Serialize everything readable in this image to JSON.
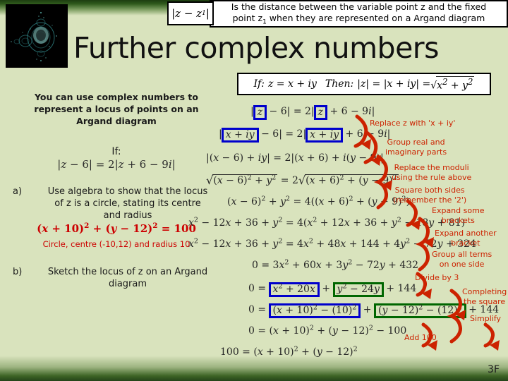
{
  "slide": {
    "page_number": "3F",
    "title": "Further complex numbers",
    "colors": {
      "background": "#d9e3bd",
      "band_dark_green": "#24441a",
      "annotation_red": "#cc2200",
      "answer_red": "#cc0000",
      "highlight_blue": "#0000cc",
      "highlight_green": "#006600"
    }
  },
  "header": {
    "modulus_label": "|z − z",
    "modulus_sub": "1",
    "modulus_tail": "|",
    "definition_line1": "Is the distance between the variable point z and the fixed",
    "definition_line2a": "point z",
    "definition_sub": "1",
    "definition_line2b": " when they are represented on a Argand diagram",
    "fractal_alt": "mandelbrot-fractal-image"
  },
  "rule_box": {
    "if_label": "If:",
    "if_expr": "z = x + iy",
    "then_label": "Then:",
    "then_expr": "|z| = |x + iy| = ",
    "then_radical": "√x² + y²"
  },
  "left": {
    "intro_line1": "You can use complex numbers to",
    "intro_line2": "represent a locus of points on an",
    "intro_line3": "Argand diagram",
    "if_word": "If:",
    "if_equation": "|z − 6| = 2|z + 6 − 9i|",
    "question_a_label": "a)",
    "question_a_line1": "Use algebra to show that the locus",
    "question_a_line2": "of z is a circle, stating its centre",
    "question_a_line3": "and radius",
    "answer_a_equation": "(x + 10)² + (y − 12)² = 100",
    "answer_a_text": "Circle, centre (-10,12) and radius 10",
    "question_b_label": "b)",
    "question_b_line1": "Sketch the locus of z on an Argand",
    "question_b_line2": "diagram"
  },
  "derivation": {
    "steps": [
      {
        "id": "step1",
        "text": "|z − 6| = 2|z + 6 − 9i|"
      },
      {
        "id": "step2",
        "text": "|x + iy − 6| = 2|x + iy + 6 − 9i|"
      },
      {
        "id": "step3",
        "text": "|(x − 6) + iy| = 2|(x + 6) + i(y − 9)|"
      },
      {
        "id": "step4",
        "text": "√((x − 6)² + y²) = 2√((x + 6)² + (y − 9)²)"
      },
      {
        "id": "step5",
        "text": "(x − 6)² + y² = 4((x + 6)² + (y − 9)²)"
      },
      {
        "id": "step6",
        "text": "x² − 12x + 36 + y² = 4(x² + 12x + 36 + y² − 18y + 81)"
      },
      {
        "id": "step7",
        "text": "x² − 12x + 36 + y² = 4x² + 48x + 144 + 4y² − 72y + 324"
      },
      {
        "id": "step8",
        "text": "0 = 3x² + 60x + 3y² − 72y + 432"
      },
      {
        "id": "step9",
        "text": "0 = x² + 20x + y² − 24y + 144"
      },
      {
        "id": "step10",
        "text": "0 = (x + 10)² − (10)² + (y − 12)² − (12)² + 144"
      },
      {
        "id": "step11",
        "text": "0 = (x + 10)² + (y − 12)² − 100"
      },
      {
        "id": "step12",
        "text": "100 = (x + 10)² + (y − 12)²"
      }
    ],
    "highlights": {
      "step1_a": "z",
      "step1_b": "z",
      "step2_a": "x + iy",
      "step2_b": "x + iy",
      "step9_blue": "x² + 20x",
      "step9_green": "y² − 24y",
      "step10_blue": "(x + 10)² − (10)²",
      "step10_green": "(y − 12)² − (12)²"
    }
  },
  "annotations": [
    {
      "id": "note1",
      "lines": [
        "Replace z with 'x + iy'"
      ]
    },
    {
      "id": "note2",
      "lines": [
        "Group real and",
        "imaginary parts"
      ]
    },
    {
      "id": "note3",
      "lines": [
        "Replace the moduli",
        "using the rule above"
      ]
    },
    {
      "id": "note4",
      "lines": [
        "Square both sides",
        "(remember the '2')"
      ]
    },
    {
      "id": "note5",
      "lines": [
        "Expand some",
        "brackets"
      ]
    },
    {
      "id": "note6",
      "lines": [
        "Expand another",
        "bracket"
      ]
    },
    {
      "id": "note7",
      "lines": [
        "Group all terms",
        "on one side"
      ]
    },
    {
      "id": "note8",
      "lines": [
        "Divide by 3"
      ]
    },
    {
      "id": "note9",
      "lines": [
        "Completing",
        "the square"
      ]
    },
    {
      "id": "note10",
      "lines": [
        "Simplify"
      ]
    },
    {
      "id": "note11",
      "lines": [
        "Add 100"
      ]
    }
  ]
}
